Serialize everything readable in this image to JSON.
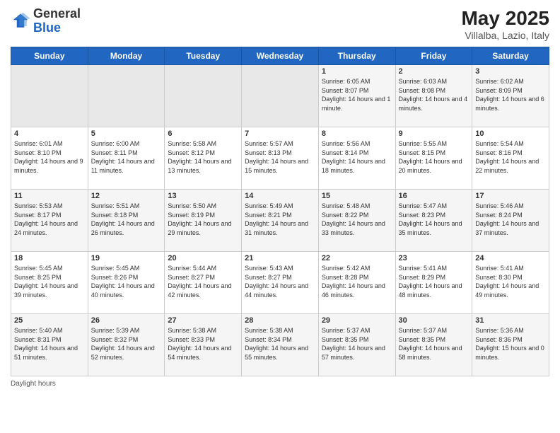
{
  "header": {
    "logo_general": "General",
    "logo_blue": "Blue",
    "title": "May 2025",
    "location": "Villalba, Lazio, Italy"
  },
  "weekdays": [
    "Sunday",
    "Monday",
    "Tuesday",
    "Wednesday",
    "Thursday",
    "Friday",
    "Saturday"
  ],
  "weeks": [
    [
      {
        "day": "",
        "empty": true
      },
      {
        "day": "",
        "empty": true
      },
      {
        "day": "",
        "empty": true
      },
      {
        "day": "",
        "empty": true
      },
      {
        "day": "1",
        "sunrise": "Sunrise: 6:05 AM",
        "sunset": "Sunset: 8:07 PM",
        "daylight": "Daylight: 14 hours and 1 minute."
      },
      {
        "day": "2",
        "sunrise": "Sunrise: 6:03 AM",
        "sunset": "Sunset: 8:08 PM",
        "daylight": "Daylight: 14 hours and 4 minutes."
      },
      {
        "day": "3",
        "sunrise": "Sunrise: 6:02 AM",
        "sunset": "Sunset: 8:09 PM",
        "daylight": "Daylight: 14 hours and 6 minutes."
      }
    ],
    [
      {
        "day": "4",
        "sunrise": "Sunrise: 6:01 AM",
        "sunset": "Sunset: 8:10 PM",
        "daylight": "Daylight: 14 hours and 9 minutes."
      },
      {
        "day": "5",
        "sunrise": "Sunrise: 6:00 AM",
        "sunset": "Sunset: 8:11 PM",
        "daylight": "Daylight: 14 hours and 11 minutes."
      },
      {
        "day": "6",
        "sunrise": "Sunrise: 5:58 AM",
        "sunset": "Sunset: 8:12 PM",
        "daylight": "Daylight: 14 hours and 13 minutes."
      },
      {
        "day": "7",
        "sunrise": "Sunrise: 5:57 AM",
        "sunset": "Sunset: 8:13 PM",
        "daylight": "Daylight: 14 hours and 15 minutes."
      },
      {
        "day": "8",
        "sunrise": "Sunrise: 5:56 AM",
        "sunset": "Sunset: 8:14 PM",
        "daylight": "Daylight: 14 hours and 18 minutes."
      },
      {
        "day": "9",
        "sunrise": "Sunrise: 5:55 AM",
        "sunset": "Sunset: 8:15 PM",
        "daylight": "Daylight: 14 hours and 20 minutes."
      },
      {
        "day": "10",
        "sunrise": "Sunrise: 5:54 AM",
        "sunset": "Sunset: 8:16 PM",
        "daylight": "Daylight: 14 hours and 22 minutes."
      }
    ],
    [
      {
        "day": "11",
        "sunrise": "Sunrise: 5:53 AM",
        "sunset": "Sunset: 8:17 PM",
        "daylight": "Daylight: 14 hours and 24 minutes."
      },
      {
        "day": "12",
        "sunrise": "Sunrise: 5:51 AM",
        "sunset": "Sunset: 8:18 PM",
        "daylight": "Daylight: 14 hours and 26 minutes."
      },
      {
        "day": "13",
        "sunrise": "Sunrise: 5:50 AM",
        "sunset": "Sunset: 8:19 PM",
        "daylight": "Daylight: 14 hours and 29 minutes."
      },
      {
        "day": "14",
        "sunrise": "Sunrise: 5:49 AM",
        "sunset": "Sunset: 8:21 PM",
        "daylight": "Daylight: 14 hours and 31 minutes."
      },
      {
        "day": "15",
        "sunrise": "Sunrise: 5:48 AM",
        "sunset": "Sunset: 8:22 PM",
        "daylight": "Daylight: 14 hours and 33 minutes."
      },
      {
        "day": "16",
        "sunrise": "Sunrise: 5:47 AM",
        "sunset": "Sunset: 8:23 PM",
        "daylight": "Daylight: 14 hours and 35 minutes."
      },
      {
        "day": "17",
        "sunrise": "Sunrise: 5:46 AM",
        "sunset": "Sunset: 8:24 PM",
        "daylight": "Daylight: 14 hours and 37 minutes."
      }
    ],
    [
      {
        "day": "18",
        "sunrise": "Sunrise: 5:45 AM",
        "sunset": "Sunset: 8:25 PM",
        "daylight": "Daylight: 14 hours and 39 minutes."
      },
      {
        "day": "19",
        "sunrise": "Sunrise: 5:45 AM",
        "sunset": "Sunset: 8:26 PM",
        "daylight": "Daylight: 14 hours and 40 minutes."
      },
      {
        "day": "20",
        "sunrise": "Sunrise: 5:44 AM",
        "sunset": "Sunset: 8:27 PM",
        "daylight": "Daylight: 14 hours and 42 minutes."
      },
      {
        "day": "21",
        "sunrise": "Sunrise: 5:43 AM",
        "sunset": "Sunset: 8:27 PM",
        "daylight": "Daylight: 14 hours and 44 minutes."
      },
      {
        "day": "22",
        "sunrise": "Sunrise: 5:42 AM",
        "sunset": "Sunset: 8:28 PM",
        "daylight": "Daylight: 14 hours and 46 minutes."
      },
      {
        "day": "23",
        "sunrise": "Sunrise: 5:41 AM",
        "sunset": "Sunset: 8:29 PM",
        "daylight": "Daylight: 14 hours and 48 minutes."
      },
      {
        "day": "24",
        "sunrise": "Sunrise: 5:41 AM",
        "sunset": "Sunset: 8:30 PM",
        "daylight": "Daylight: 14 hours and 49 minutes."
      }
    ],
    [
      {
        "day": "25",
        "sunrise": "Sunrise: 5:40 AM",
        "sunset": "Sunset: 8:31 PM",
        "daylight": "Daylight: 14 hours and 51 minutes."
      },
      {
        "day": "26",
        "sunrise": "Sunrise: 5:39 AM",
        "sunset": "Sunset: 8:32 PM",
        "daylight": "Daylight: 14 hours and 52 minutes."
      },
      {
        "day": "27",
        "sunrise": "Sunrise: 5:38 AM",
        "sunset": "Sunset: 8:33 PM",
        "daylight": "Daylight: 14 hours and 54 minutes."
      },
      {
        "day": "28",
        "sunrise": "Sunrise: 5:38 AM",
        "sunset": "Sunset: 8:34 PM",
        "daylight": "Daylight: 14 hours and 55 minutes."
      },
      {
        "day": "29",
        "sunrise": "Sunrise: 5:37 AM",
        "sunset": "Sunset: 8:35 PM",
        "daylight": "Daylight: 14 hours and 57 minutes."
      },
      {
        "day": "30",
        "sunrise": "Sunrise: 5:37 AM",
        "sunset": "Sunset: 8:35 PM",
        "daylight": "Daylight: 14 hours and 58 minutes."
      },
      {
        "day": "31",
        "sunrise": "Sunrise: 5:36 AM",
        "sunset": "Sunset: 8:36 PM",
        "daylight": "Daylight: 15 hours and 0 minutes."
      }
    ]
  ],
  "legend": {
    "daylight_hours": "Daylight hours"
  }
}
